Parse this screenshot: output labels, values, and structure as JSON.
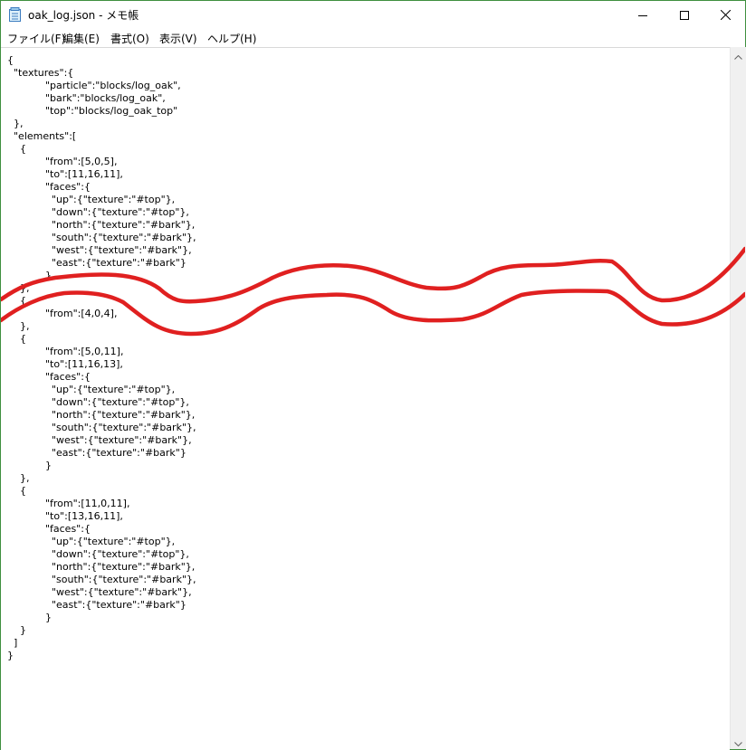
{
  "window": {
    "title": "oak_log.json - メモ帳",
    "icons": {
      "app": "notepad-icon",
      "minimize": "minimize-icon",
      "maximize": "maximize-icon",
      "close": "close-icon"
    }
  },
  "menu": {
    "file": "ファイル(F)",
    "edit": "編集(E)",
    "format": "書式(O)",
    "view": "表示(V)",
    "help": "ヘルプ(H)"
  },
  "editor": {
    "lines": [
      "{",
      "  \"textures\":{",
      "            \"particle\":\"blocks/log_oak\",",
      "            \"bark\":\"blocks/log_oak\",",
      "            \"top\":\"blocks/log_oak_top\"",
      "  },",
      "  \"elements\":[",
      "    {",
      "            \"from\":[5,0,5],",
      "            \"to\":[11,16,11],",
      "            \"faces\":{",
      "              \"up\":{\"texture\":\"#top\"},",
      "              \"down\":{\"texture\":\"#top\"},",
      "              \"north\":{\"texture\":\"#bark\"},",
      "              \"south\":{\"texture\":\"#bark\"},",
      "              \"west\":{\"texture\":\"#bark\"},",
      "              \"east\":{\"texture\":\"#bark\"}",
      "            }",
      "    },",
      "    {",
      "            \"from\":[4,0,4],",
      "    },",
      "    {",
      "            \"from\":[5,0,11],",
      "            \"to\":[11,16,13],",
      "            \"faces\":{",
      "              \"up\":{\"texture\":\"#top\"},",
      "              \"down\":{\"texture\":\"#top\"},",
      "              \"north\":{\"texture\":\"#bark\"},",
      "              \"south\":{\"texture\":\"#bark\"},",
      "              \"west\":{\"texture\":\"#bark\"},",
      "              \"east\":{\"texture\":\"#bark\"}",
      "            }",
      "    },",
      "    {",
      "            \"from\":[11,0,11],",
      "            \"to\":[13,16,11],",
      "            \"faces\":{",
      "              \"up\":{\"texture\":\"#top\"},",
      "              \"down\":{\"texture\":\"#top\"},",
      "              \"north\":{\"texture\":\"#bark\"},",
      "              \"south\":{\"texture\":\"#bark\"},",
      "              \"west\":{\"texture\":\"#bark\"},",
      "              \"east\":{\"texture\":\"#bark\"}",
      "            }",
      "    }",
      "  ]",
      "}"
    ]
  },
  "scrollbar": {
    "icons": {
      "up": "scroll-up-icon",
      "down": "scroll-down-icon"
    }
  },
  "annotation": {
    "color": "#e02020",
    "icon": "red-scribble-annotation"
  }
}
